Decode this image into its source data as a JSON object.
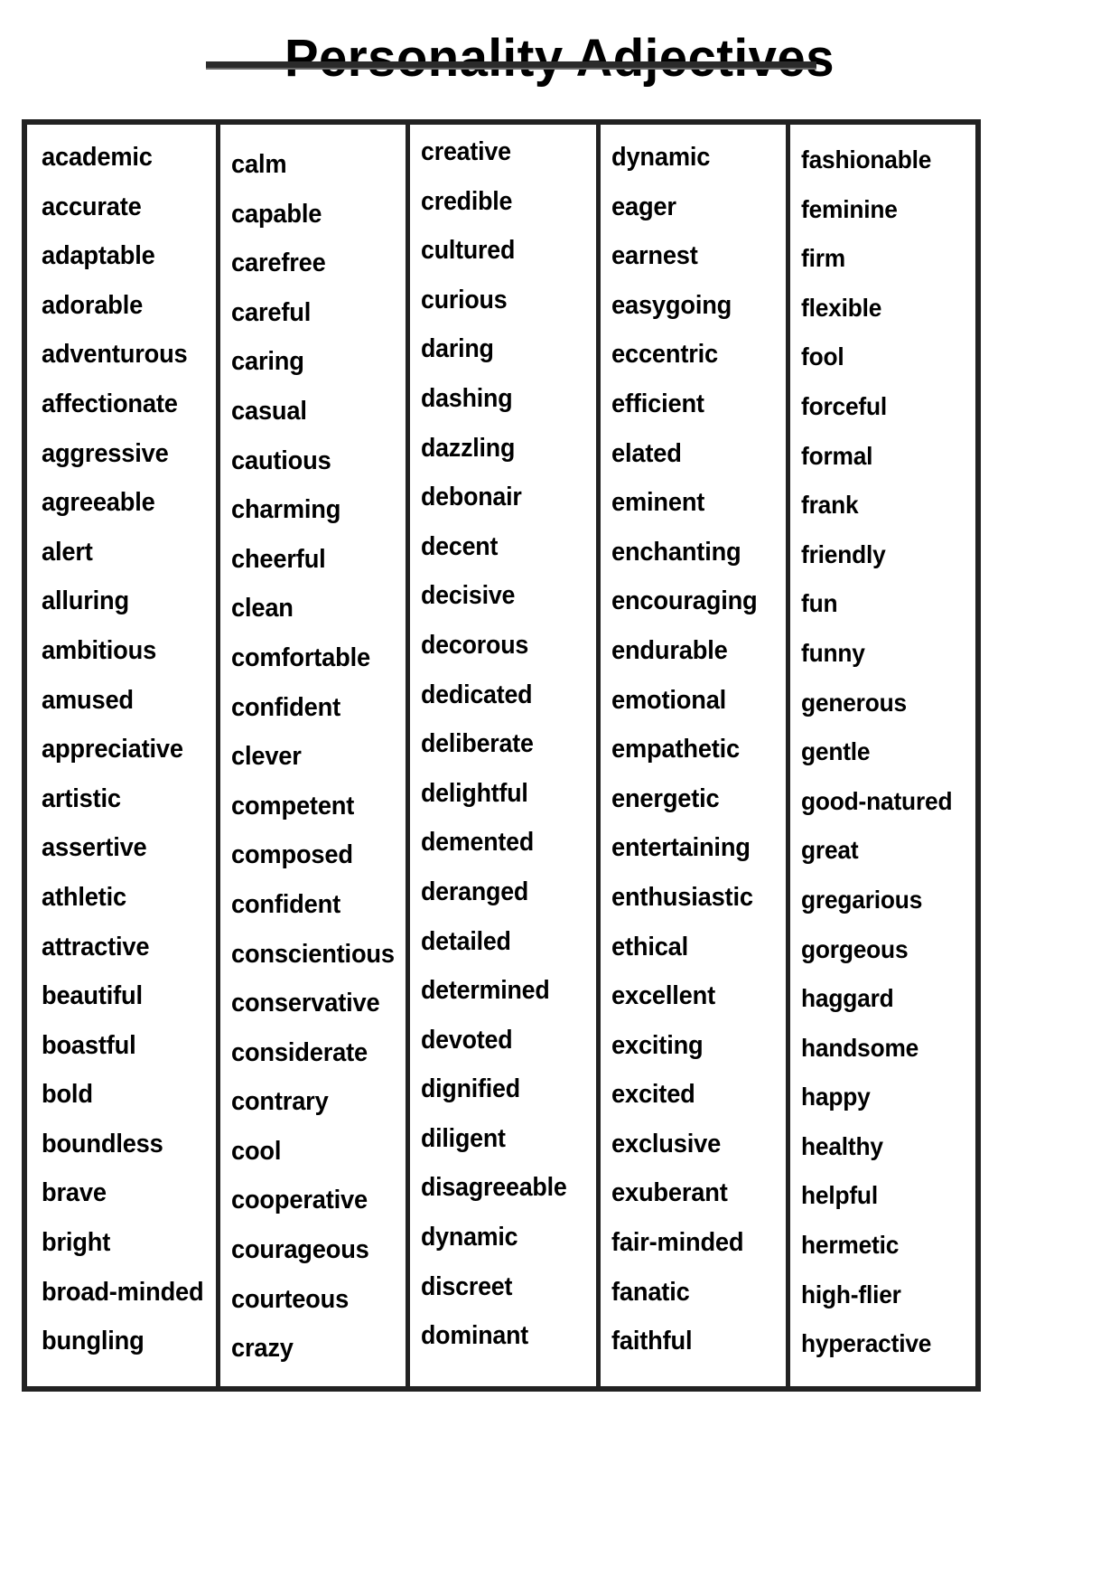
{
  "document": {
    "title": "Personality Adjectives",
    "accent_color": "#222222",
    "text_color": "#000000",
    "background_color": "#ffffff"
  },
  "table": {
    "column_count": 5,
    "columns": [
      {
        "name": "column-a",
        "words": [
          "academic",
          "accurate",
          "adaptable",
          "adorable",
          "adventurous",
          "affectionate",
          "aggressive",
          "agreeable",
          "alert",
          "alluring",
          "ambitious",
          "amused",
          "appreciative",
          "artistic",
          "assertive",
          "athletic",
          "attractive",
          "beautiful",
          "boastful",
          "bold",
          "boundless",
          "brave",
          "bright",
          "broad-minded",
          "bungling"
        ]
      },
      {
        "name": "column-c",
        "words": [
          "calm",
          "capable",
          "carefree",
          "careful",
          "caring",
          "casual",
          "cautious",
          "charming",
          "cheerful",
          "clean",
          "comfortable",
          "confident",
          "clever",
          "competent",
          "composed",
          "confident",
          "conscientious",
          "conservative",
          "considerate",
          "contrary",
          "cool",
          "cooperative",
          "courageous",
          "courteous",
          "crazy"
        ]
      },
      {
        "name": "column-cr-d",
        "words": [
          "creative",
          "credible",
          "cultured",
          "curious",
          "daring",
          "dashing",
          "dazzling",
          "debonair",
          "decent",
          "decisive",
          "decorous",
          "dedicated",
          "deliberate",
          "delightful",
          "demented",
          "deranged",
          "detailed",
          "determined",
          "devoted",
          "dignified",
          "diligent",
          "disagreeable",
          "dynamic",
          "discreet",
          "dominant"
        ]
      },
      {
        "name": "column-e-f",
        "words": [
          "dynamic",
          "eager",
          "earnest",
          "easygoing",
          "eccentric",
          "efficient",
          "elated",
          "eminent",
          "enchanting",
          "encouraging",
          "endurable",
          "emotional",
          "empathetic",
          "energetic",
          "entertaining",
          "enthusiastic",
          "ethical",
          "excellent",
          "exciting",
          "excited",
          "exclusive",
          "exuberant",
          "fair-minded",
          "fanatic",
          "faithful"
        ]
      },
      {
        "name": "column-f-h",
        "words": [
          "fashionable",
          "feminine",
          "firm",
          "flexible",
          "fool",
          "forceful",
          "formal",
          "frank",
          "friendly",
          "fun",
          "funny",
          "generous",
          "gentle",
          "good-natured",
          "great",
          "gregarious",
          "gorgeous",
          "haggard",
          "handsome",
          "happy",
          "healthy",
          "helpful",
          "hermetic",
          "high-flier",
          "hyperactive"
        ]
      }
    ]
  }
}
